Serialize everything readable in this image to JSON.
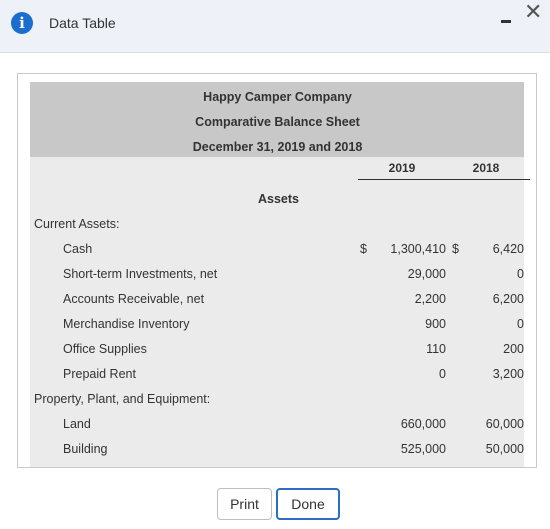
{
  "window": {
    "title": "Data Table"
  },
  "statement": {
    "company": "Happy Camper Company",
    "name": "Comparative Balance Sheet",
    "date": "December 31, 2019 and 2018",
    "col_2019": "2019",
    "col_2018": "2018",
    "section": "Assets"
  },
  "groups": {
    "current": "Current Assets:",
    "ppe": "Property, Plant, and Equipment:"
  },
  "rows": [
    {
      "label": "Cash",
      "dollar_2019": "$",
      "v2019": "1,300,410",
      "dollar_2018": "$",
      "v2018": "6,420"
    },
    {
      "label": "Short-term Investments, net",
      "v2019": "29,000",
      "v2018": "0"
    },
    {
      "label": "Accounts Receivable, net",
      "v2019": "2,200",
      "v2018": "6,200"
    },
    {
      "label": "Merchandise Inventory",
      "v2019": "900",
      "v2018": "0"
    },
    {
      "label": "Office Supplies",
      "v2019": "110",
      "v2018": "200"
    },
    {
      "label": "Prepaid Rent",
      "v2019": "0",
      "v2018": "3,200"
    },
    {
      "label": "Land",
      "v2019": "660,000",
      "v2018": "60,000"
    },
    {
      "label": "Building",
      "v2019": "525,000",
      "v2018": "50,000"
    }
  ],
  "buttons": {
    "print": "Print",
    "done": "Done"
  }
}
